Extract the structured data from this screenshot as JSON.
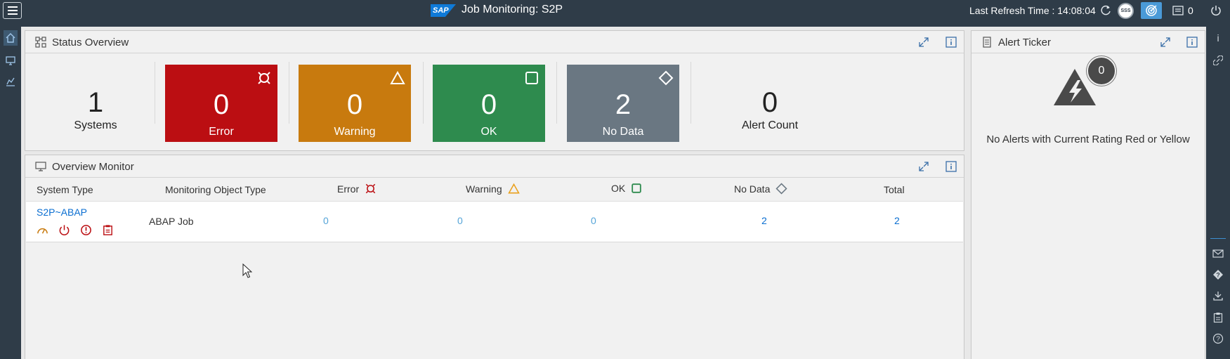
{
  "shell": {
    "logo_text": "SAP",
    "title": "Job Monitoring: S2P",
    "refresh_label": "Last Refresh Time : 14:08:04",
    "security_badge": "SSS",
    "notification_count": "0"
  },
  "status_overview": {
    "title": "Status Overview",
    "systems": {
      "value": "1",
      "label": "Systems"
    },
    "tiles": [
      {
        "key": "error",
        "value": "0",
        "label": "Error",
        "color": "#bb0e12"
      },
      {
        "key": "warning",
        "value": "0",
        "label": "Warning",
        "color": "#c87a0e"
      },
      {
        "key": "ok",
        "value": "0",
        "label": "OK",
        "color": "#2e8b4e"
      },
      {
        "key": "nodata",
        "value": "2",
        "label": "No Data",
        "color": "#6a7782"
      }
    ],
    "alert_count": {
      "value": "0",
      "label": "Alert Count"
    }
  },
  "overview_monitor": {
    "title": "Overview Monitor",
    "columns": [
      "System Type",
      "Monitoring Object Type",
      "Error",
      "Warning",
      "OK",
      "No Data",
      "Total"
    ],
    "rows": [
      {
        "system_type": "S2P~ABAP",
        "object_type": "ABAP Job",
        "error": "0",
        "warning": "0",
        "ok": "0",
        "nodata": "2",
        "total": "2"
      }
    ]
  },
  "alert_ticker": {
    "title": "Alert Ticker",
    "count": "0",
    "message": "No Alerts with Current Rating Red or Yellow"
  },
  "colors": {
    "shell_bg": "#2f3c48",
    "error": "#bb0e12",
    "warning": "#e9a01b",
    "ok": "#2e8b4e",
    "nodata": "#6a7782",
    "link": "#0a6ed1"
  }
}
